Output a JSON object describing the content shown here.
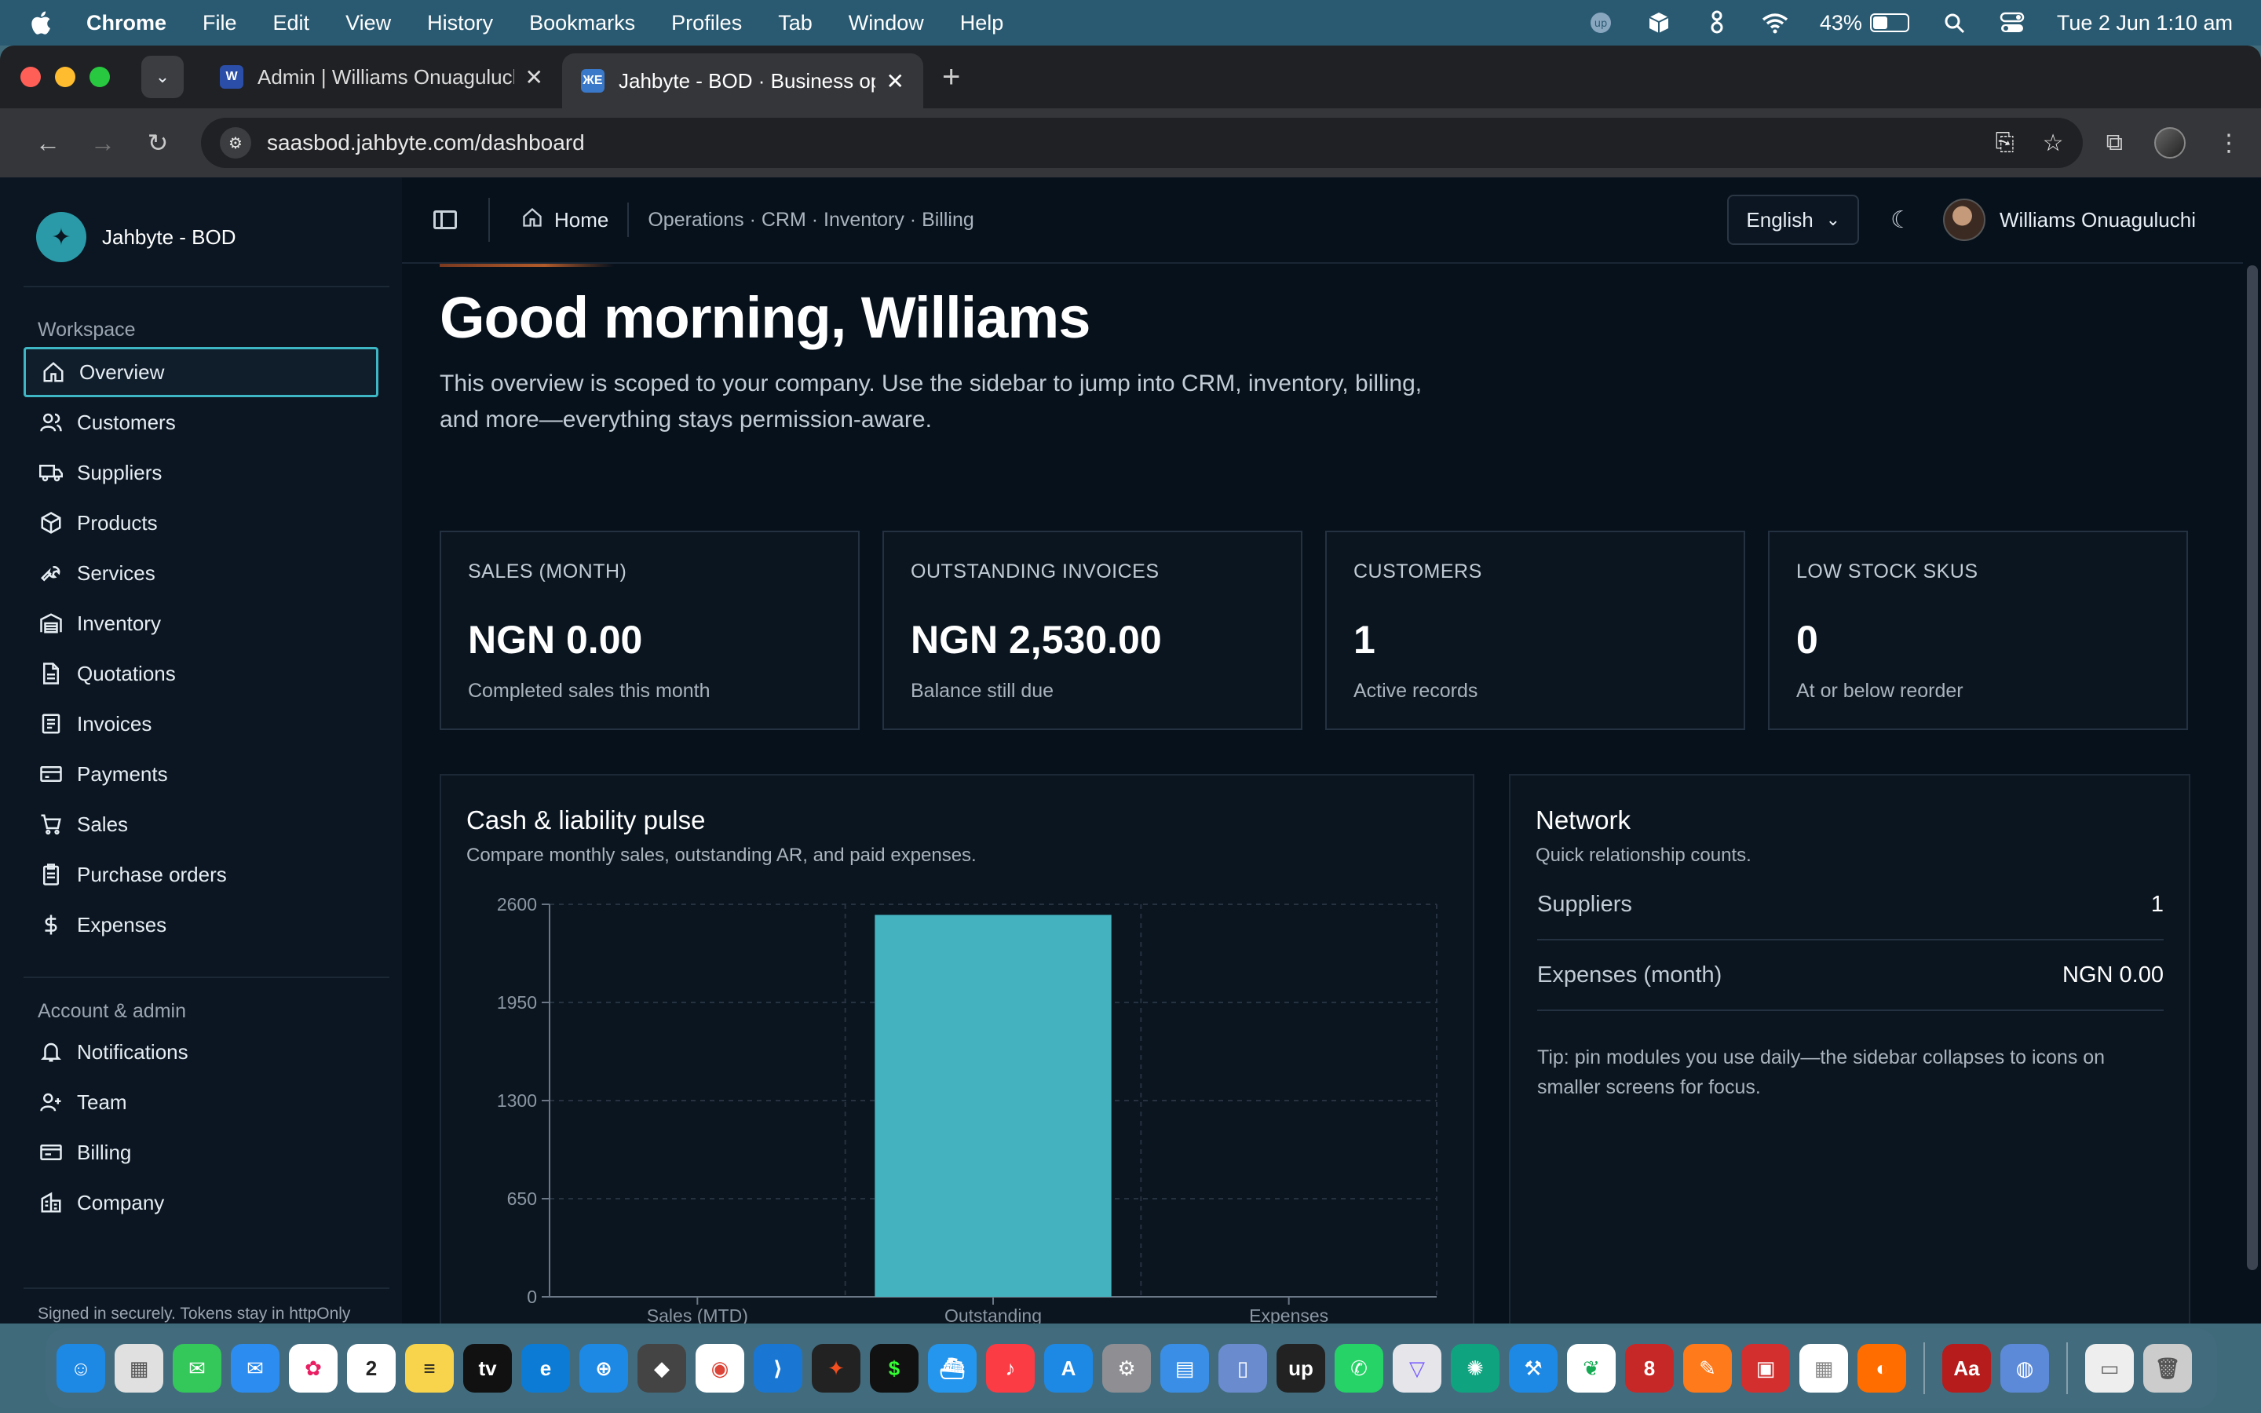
{
  "menubar": {
    "app": "Chrome",
    "items": [
      "File",
      "Edit",
      "View",
      "History",
      "Bookmarks",
      "Profiles",
      "Tab",
      "Window",
      "Help"
    ],
    "battery": "43%",
    "battery_level": 0.43,
    "datetime": "Tue 2 Jun  1:10 am"
  },
  "browser": {
    "tabs": [
      {
        "title": "Admin | Williams Onuaguluchi",
        "favicon": "W",
        "favicon_color": "#2b4ea8"
      },
      {
        "title": "Jahbyte - BOD · Business ope",
        "favicon": "ЖΕ",
        "favicon_color": "#3a78c9"
      }
    ],
    "url": "saasbod.jahbyte.com/dashboard"
  },
  "sidebar": {
    "brand": "Jahbyte - BOD",
    "workspace_label": "Workspace",
    "workspace": [
      {
        "label": "Overview",
        "icon": "home-icon",
        "active": true
      },
      {
        "label": "Customers",
        "icon": "users-icon"
      },
      {
        "label": "Suppliers",
        "icon": "truck-icon"
      },
      {
        "label": "Products",
        "icon": "package-icon"
      },
      {
        "label": "Services",
        "icon": "wrench-icon"
      },
      {
        "label": "Inventory",
        "icon": "warehouse-icon"
      },
      {
        "label": "Quotations",
        "icon": "file-icon"
      },
      {
        "label": "Invoices",
        "icon": "receipt-icon"
      },
      {
        "label": "Payments",
        "icon": "credit-card-icon"
      },
      {
        "label": "Sales",
        "icon": "cart-icon"
      },
      {
        "label": "Purchase orders",
        "icon": "clipboard-icon"
      },
      {
        "label": "Expenses",
        "icon": "dollar-icon"
      }
    ],
    "account_label": "Account & admin",
    "account": [
      {
        "label": "Notifications",
        "icon": "bell-icon"
      },
      {
        "label": "Team",
        "icon": "user-plus-icon"
      },
      {
        "label": "Billing",
        "icon": "wallet-icon"
      },
      {
        "label": "Company",
        "icon": "building-icon"
      }
    ],
    "footer": "Signed in securely. Tokens stay in httpOnly cookies."
  },
  "header": {
    "home": "Home",
    "path": "Operations · CRM · Inventory · Billing",
    "language": "English",
    "user": "Williams Onuaguluchi"
  },
  "main": {
    "greeting": "Good morning, Williams",
    "intro": "This overview is scoped to your company. Use the sidebar to jump into CRM, inventory, billing, and more—everything stays permission-aware.",
    "stats": [
      {
        "label": "SALES (MONTH)",
        "value": "NGN 0.00",
        "sub": "Completed sales this month"
      },
      {
        "label": "OUTSTANDING INVOICES",
        "value": "NGN 2,530.00",
        "sub": "Balance still due"
      },
      {
        "label": "CUSTOMERS",
        "value": "1",
        "sub": "Active records"
      },
      {
        "label": "LOW STOCK SKUS",
        "value": "0",
        "sub": "At or below reorder"
      }
    ],
    "pulse": {
      "title": "Cash & liability pulse",
      "subtitle": "Compare monthly sales, outstanding AR, and paid expenses."
    },
    "network": {
      "title": "Network",
      "subtitle": "Quick relationship counts.",
      "rows": [
        {
          "key": "Suppliers",
          "value": "1"
        },
        {
          "key": "Expenses (month)",
          "value": "NGN 0.00"
        }
      ],
      "tip": "Tip: pin modules you use daily—the sidebar collapses to icons on smaller screens for focus."
    }
  },
  "chart_data": {
    "type": "bar",
    "categories": [
      "Sales (MTD)",
      "Outstanding",
      "Expenses"
    ],
    "values": [
      0,
      2530,
      0
    ],
    "yticks": [
      0,
      650,
      1300,
      1950,
      2600
    ],
    "ylim": [
      0,
      2600
    ],
    "color": "#45b3bf",
    "grid": true
  },
  "colors": {
    "accent": "#3fb6c4",
    "background": "#07111c",
    "bar": "#45b3bf"
  }
}
